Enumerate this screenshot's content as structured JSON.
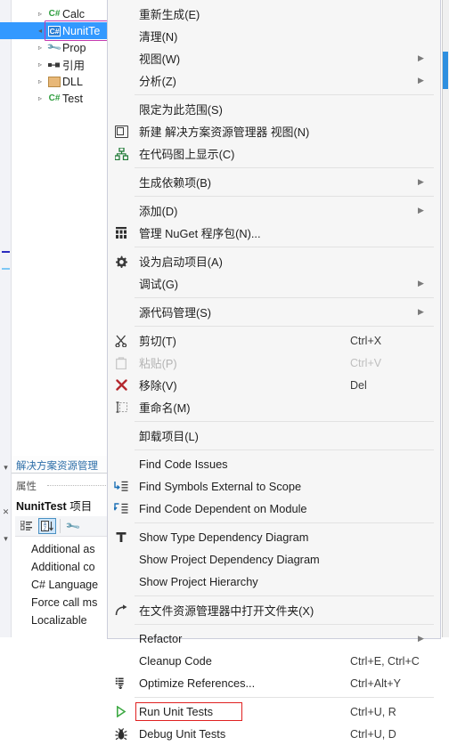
{
  "app": {
    "solution_tab_label": "解决方案资源管理",
    "properties_header": "属性",
    "properties_object": "NunitTest",
    "properties_object_suffix": " 项目"
  },
  "tree": {
    "items": [
      {
        "label": "Calc",
        "icon": "csharp-icon",
        "expander": "▹",
        "selected": false
      },
      {
        "label": "NunitTe",
        "icon": "csharp-project-icon",
        "expander": "◂",
        "selected": true
      },
      {
        "label": "Prop",
        "icon": "wrench-icon",
        "expander": "▹",
        "selected": false
      },
      {
        "label": "引用",
        "icon": "references-icon",
        "expander": "▹",
        "selected": false
      },
      {
        "label": "DLL",
        "icon": "folder-icon",
        "expander": "▹",
        "selected": false
      },
      {
        "label": "Test",
        "icon": "csharp-icon",
        "expander": "▹",
        "selected": false
      }
    ]
  },
  "properties_toolbar": {
    "categorized": "categorized-icon",
    "alphabetical": "sort-az-icon",
    "property_pages": "wrench-icon"
  },
  "properties_list": [
    "Additional as",
    "Additional co",
    "C# Language",
    "Force call ms",
    "Localizable"
  ],
  "context_menu": {
    "items": [
      {
        "label": "重新生成(E)",
        "icon": "",
        "shortcut": "",
        "submenu": false,
        "disabled": false,
        "sep_after": false
      },
      {
        "label": "清理(N)",
        "icon": "",
        "shortcut": "",
        "submenu": false,
        "disabled": false,
        "sep_after": false
      },
      {
        "label": "视图(W)",
        "icon": "",
        "shortcut": "",
        "submenu": true,
        "disabled": false,
        "sep_after": false
      },
      {
        "label": "分析(Z)",
        "icon": "",
        "shortcut": "",
        "submenu": true,
        "disabled": false,
        "sep_after": true
      },
      {
        "label": "限定为此范围(S)",
        "icon": "",
        "shortcut": "",
        "submenu": false,
        "disabled": false,
        "sep_after": false
      },
      {
        "label": "新建 解决方案资源管理器 视图(N)",
        "icon": "view-window-icon",
        "shortcut": "",
        "submenu": false,
        "disabled": false,
        "sep_after": false
      },
      {
        "label": "在代码图上显示(C)",
        "icon": "code-map-icon",
        "shortcut": "",
        "submenu": false,
        "disabled": false,
        "sep_after": true
      },
      {
        "label": "生成依赖项(B)",
        "icon": "",
        "shortcut": "",
        "submenu": true,
        "disabled": false,
        "sep_after": true
      },
      {
        "label": "添加(D)",
        "icon": "",
        "shortcut": "",
        "submenu": true,
        "disabled": false,
        "sep_after": false
      },
      {
        "label": "管理 NuGet 程序包(N)...",
        "icon": "nuget-icon",
        "shortcut": "",
        "submenu": false,
        "disabled": false,
        "sep_after": true
      },
      {
        "label": "设为启动项目(A)",
        "icon": "gear-icon",
        "shortcut": "",
        "submenu": false,
        "disabled": false,
        "sep_after": false
      },
      {
        "label": "调试(G)",
        "icon": "",
        "shortcut": "",
        "submenu": true,
        "disabled": false,
        "sep_after": true
      },
      {
        "label": "源代码管理(S)",
        "icon": "",
        "shortcut": "",
        "submenu": true,
        "disabled": false,
        "sep_after": true
      },
      {
        "label": "剪切(T)",
        "icon": "scissors-icon",
        "shortcut": "Ctrl+X",
        "submenu": false,
        "disabled": false,
        "sep_after": false
      },
      {
        "label": "粘贴(P)",
        "icon": "clipboard-icon",
        "shortcut": "Ctrl+V",
        "submenu": false,
        "disabled": true,
        "sep_after": false
      },
      {
        "label": "移除(V)",
        "icon": "x-delete-icon",
        "shortcut": "Del",
        "submenu": false,
        "disabled": false,
        "sep_after": false
      },
      {
        "label": "重命名(M)",
        "icon": "rename-icon",
        "shortcut": "",
        "submenu": false,
        "disabled": false,
        "sep_after": true
      },
      {
        "label": "卸载项目(L)",
        "icon": "",
        "shortcut": "",
        "submenu": false,
        "disabled": false,
        "sep_after": true
      },
      {
        "label": "Find Code Issues",
        "icon": "",
        "shortcut": "",
        "submenu": false,
        "disabled": false,
        "sep_after": false
      },
      {
        "label": "Find Symbols External to Scope",
        "icon": "find-symbols-icon",
        "shortcut": "",
        "submenu": false,
        "disabled": false,
        "sep_after": false
      },
      {
        "label": "Find Code Dependent on Module",
        "icon": "find-dependent-icon",
        "shortcut": "",
        "submenu": false,
        "disabled": false,
        "sep_after": true
      },
      {
        "label": "Show Type Dependency Diagram",
        "icon": "type-diagram-icon",
        "shortcut": "",
        "submenu": false,
        "disabled": false,
        "sep_after": false
      },
      {
        "label": "Show Project Dependency Diagram",
        "icon": "",
        "shortcut": "",
        "submenu": false,
        "disabled": false,
        "sep_after": false
      },
      {
        "label": "Show Project Hierarchy",
        "icon": "",
        "shortcut": "",
        "submenu": false,
        "disabled": false,
        "sep_after": true
      },
      {
        "label": "在文件资源管理器中打开文件夹(X)",
        "icon": "open-folder-arrow-icon",
        "shortcut": "",
        "submenu": false,
        "disabled": false,
        "sep_after": true
      },
      {
        "label": "Refactor",
        "icon": "",
        "shortcut": "",
        "submenu": true,
        "disabled": false,
        "sep_after": false
      },
      {
        "label": "Cleanup Code",
        "icon": "",
        "shortcut": "Ctrl+E, Ctrl+C",
        "submenu": false,
        "disabled": false,
        "sep_after": false
      },
      {
        "label": "Optimize References...",
        "icon": "optimize-refs-icon",
        "shortcut": "Ctrl+Alt+Y",
        "submenu": false,
        "disabled": false,
        "sep_after": true
      },
      {
        "label": "Run Unit Tests",
        "icon": "run-play-icon",
        "shortcut": "Ctrl+U, R",
        "submenu": false,
        "disabled": false,
        "sep_after": false,
        "highlighted": true
      },
      {
        "label": "Debug Unit Tests",
        "icon": "debug-bug-icon",
        "shortcut": "Ctrl+U, D",
        "submenu": false,
        "disabled": false,
        "sep_after": false
      }
    ]
  },
  "colors": {
    "menu_bg": "#f6f6f6",
    "selection_blue": "#3399ff",
    "annotation_red": "#e02020",
    "selection_outline": "#c23ab0",
    "scrollbar_thumb": "#2e8fe0"
  }
}
